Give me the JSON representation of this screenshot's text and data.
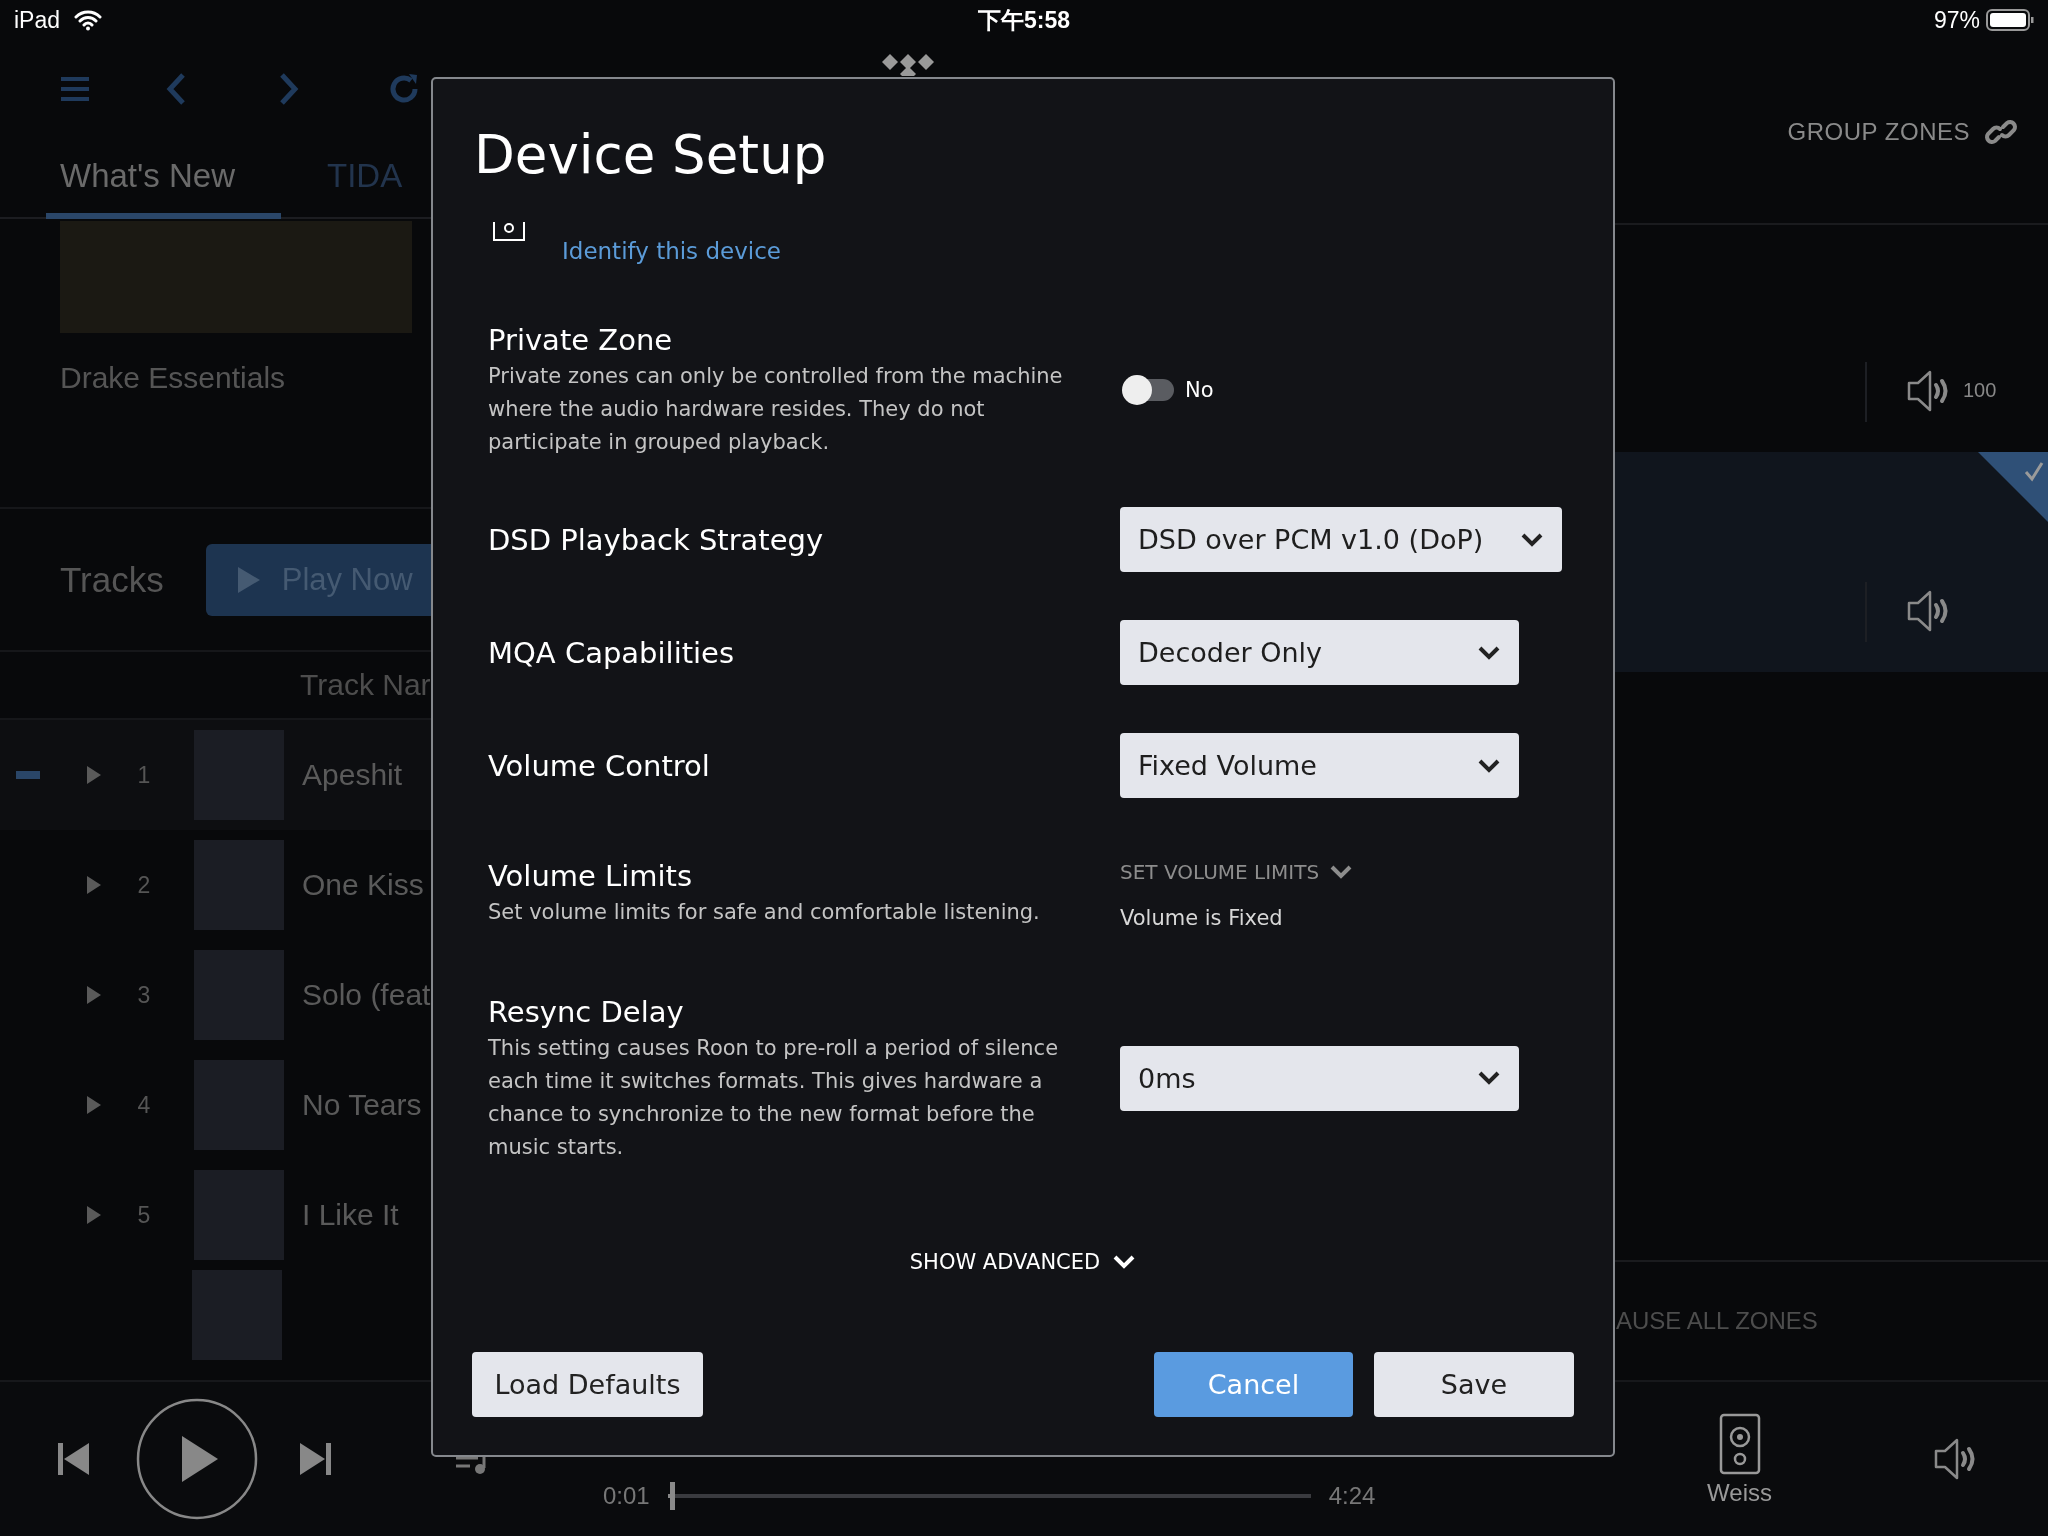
{
  "status_bar": {
    "device": "iPad",
    "time": "下午5:58",
    "battery": "97%"
  },
  "nav": {
    "tabs": [
      {
        "label": "What's New",
        "selected": true
      },
      {
        "label": "TIDA",
        "selected": false
      }
    ]
  },
  "album": {
    "title": "Drake Essentials"
  },
  "tracks": {
    "heading": "Tracks",
    "play_button": "Play Now",
    "column": "Track Nar",
    "rows": [
      {
        "number": "1",
        "title": "Apeshit",
        "selected": true
      },
      {
        "number": "2",
        "title": "One Kiss",
        "selected": false
      },
      {
        "number": "3",
        "title": "Solo (feat",
        "selected": false
      },
      {
        "number": "4",
        "title": "No Tears",
        "selected": false
      },
      {
        "number": "5",
        "title": "I Like It",
        "selected": false
      }
    ]
  },
  "zones": {
    "group_button": "GROUP ZONES",
    "items": [
      {
        "volume": "100",
        "selected": false
      },
      {
        "selected": true
      }
    ],
    "pause_all": "AUSE ALL ZONES"
  },
  "player": {
    "elapsed": "0:01",
    "duration": "4:24",
    "level": 0.004,
    "device": "Weiss"
  },
  "dialog": {
    "title": "Device Setup",
    "identify_link": "Identify this device",
    "settings": [
      {
        "kind": "toggle",
        "label": "Private Zone",
        "description": "Private zones can only be controlled from the machine where the audio hardware resides. They do not participate in grouped playback.",
        "on": false,
        "value": "No"
      },
      {
        "kind": "dropdown",
        "label": "DSD Playback Strategy",
        "value": "DSD over PCM v1.0 (DoP)"
      },
      {
        "kind": "dropdown",
        "label": "MQA Capabilities",
        "value": "Decoder Only"
      },
      {
        "kind": "dropdown",
        "label": "Volume Control",
        "value": "Fixed Volume"
      },
      {
        "kind": "limits",
        "label": "Volume Limits",
        "description": "Set volume limits for safe and comfortable listening.",
        "action": "SET VOLUME LIMITS",
        "note": "Volume is Fixed"
      },
      {
        "kind": "dropdown",
        "label": "Resync Delay",
        "description": "This setting causes Roon to pre-roll a period of silence each time it switches formats. This gives hardware a chance to synchronize to the new format before the music starts.",
        "value": "0ms"
      }
    ],
    "advanced": "SHOW ADVANCED",
    "buttons": [
      {
        "label": "Load Defaults",
        "kind": "secondary"
      },
      {
        "label": "Cancel",
        "kind": "primary"
      },
      {
        "label": "Save",
        "kind": "secondary"
      }
    ]
  }
}
